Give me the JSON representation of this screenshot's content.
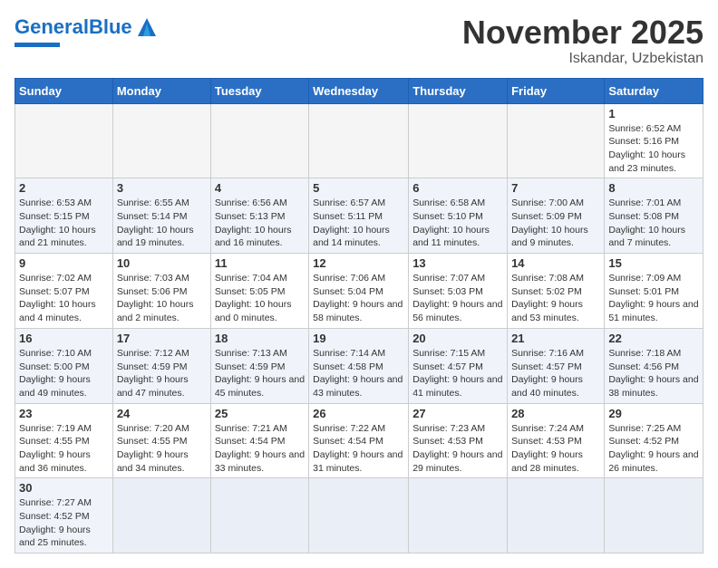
{
  "header": {
    "logo_general": "General",
    "logo_blue": "Blue",
    "month_title": "November 2025",
    "location": "Iskandar, Uzbekistan"
  },
  "weekdays": [
    "Sunday",
    "Monday",
    "Tuesday",
    "Wednesday",
    "Thursday",
    "Friday",
    "Saturday"
  ],
  "weeks": [
    [
      {
        "day": "",
        "info": ""
      },
      {
        "day": "",
        "info": ""
      },
      {
        "day": "",
        "info": ""
      },
      {
        "day": "",
        "info": ""
      },
      {
        "day": "",
        "info": ""
      },
      {
        "day": "",
        "info": ""
      },
      {
        "day": "1",
        "info": "Sunrise: 6:52 AM\nSunset: 5:16 PM\nDaylight: 10 hours and 23 minutes."
      }
    ],
    [
      {
        "day": "2",
        "info": "Sunrise: 6:53 AM\nSunset: 5:15 PM\nDaylight: 10 hours and 21 minutes."
      },
      {
        "day": "3",
        "info": "Sunrise: 6:55 AM\nSunset: 5:14 PM\nDaylight: 10 hours and 19 minutes."
      },
      {
        "day": "4",
        "info": "Sunrise: 6:56 AM\nSunset: 5:13 PM\nDaylight: 10 hours and 16 minutes."
      },
      {
        "day": "5",
        "info": "Sunrise: 6:57 AM\nSunset: 5:11 PM\nDaylight: 10 hours and 14 minutes."
      },
      {
        "day": "6",
        "info": "Sunrise: 6:58 AM\nSunset: 5:10 PM\nDaylight: 10 hours and 11 minutes."
      },
      {
        "day": "7",
        "info": "Sunrise: 7:00 AM\nSunset: 5:09 PM\nDaylight: 10 hours and 9 minutes."
      },
      {
        "day": "8",
        "info": "Sunrise: 7:01 AM\nSunset: 5:08 PM\nDaylight: 10 hours and 7 minutes."
      }
    ],
    [
      {
        "day": "9",
        "info": "Sunrise: 7:02 AM\nSunset: 5:07 PM\nDaylight: 10 hours and 4 minutes."
      },
      {
        "day": "10",
        "info": "Sunrise: 7:03 AM\nSunset: 5:06 PM\nDaylight: 10 hours and 2 minutes."
      },
      {
        "day": "11",
        "info": "Sunrise: 7:04 AM\nSunset: 5:05 PM\nDaylight: 10 hours and 0 minutes."
      },
      {
        "day": "12",
        "info": "Sunrise: 7:06 AM\nSunset: 5:04 PM\nDaylight: 9 hours and 58 minutes."
      },
      {
        "day": "13",
        "info": "Sunrise: 7:07 AM\nSunset: 5:03 PM\nDaylight: 9 hours and 56 minutes."
      },
      {
        "day": "14",
        "info": "Sunrise: 7:08 AM\nSunset: 5:02 PM\nDaylight: 9 hours and 53 minutes."
      },
      {
        "day": "15",
        "info": "Sunrise: 7:09 AM\nSunset: 5:01 PM\nDaylight: 9 hours and 51 minutes."
      }
    ],
    [
      {
        "day": "16",
        "info": "Sunrise: 7:10 AM\nSunset: 5:00 PM\nDaylight: 9 hours and 49 minutes."
      },
      {
        "day": "17",
        "info": "Sunrise: 7:12 AM\nSunset: 4:59 PM\nDaylight: 9 hours and 47 minutes."
      },
      {
        "day": "18",
        "info": "Sunrise: 7:13 AM\nSunset: 4:59 PM\nDaylight: 9 hours and 45 minutes."
      },
      {
        "day": "19",
        "info": "Sunrise: 7:14 AM\nSunset: 4:58 PM\nDaylight: 9 hours and 43 minutes."
      },
      {
        "day": "20",
        "info": "Sunrise: 7:15 AM\nSunset: 4:57 PM\nDaylight: 9 hours and 41 minutes."
      },
      {
        "day": "21",
        "info": "Sunrise: 7:16 AM\nSunset: 4:57 PM\nDaylight: 9 hours and 40 minutes."
      },
      {
        "day": "22",
        "info": "Sunrise: 7:18 AM\nSunset: 4:56 PM\nDaylight: 9 hours and 38 minutes."
      }
    ],
    [
      {
        "day": "23",
        "info": "Sunrise: 7:19 AM\nSunset: 4:55 PM\nDaylight: 9 hours and 36 minutes."
      },
      {
        "day": "24",
        "info": "Sunrise: 7:20 AM\nSunset: 4:55 PM\nDaylight: 9 hours and 34 minutes."
      },
      {
        "day": "25",
        "info": "Sunrise: 7:21 AM\nSunset: 4:54 PM\nDaylight: 9 hours and 33 minutes."
      },
      {
        "day": "26",
        "info": "Sunrise: 7:22 AM\nSunset: 4:54 PM\nDaylight: 9 hours and 31 minutes."
      },
      {
        "day": "27",
        "info": "Sunrise: 7:23 AM\nSunset: 4:53 PM\nDaylight: 9 hours and 29 minutes."
      },
      {
        "day": "28",
        "info": "Sunrise: 7:24 AM\nSunset: 4:53 PM\nDaylight: 9 hours and 28 minutes."
      },
      {
        "day": "29",
        "info": "Sunrise: 7:25 AM\nSunset: 4:52 PM\nDaylight: 9 hours and 26 minutes."
      }
    ],
    [
      {
        "day": "30",
        "info": "Sunrise: 7:27 AM\nSunset: 4:52 PM\nDaylight: 9 hours and 25 minutes."
      },
      {
        "day": "",
        "info": ""
      },
      {
        "day": "",
        "info": ""
      },
      {
        "day": "",
        "info": ""
      },
      {
        "day": "",
        "info": ""
      },
      {
        "day": "",
        "info": ""
      },
      {
        "day": "",
        "info": ""
      }
    ]
  ]
}
